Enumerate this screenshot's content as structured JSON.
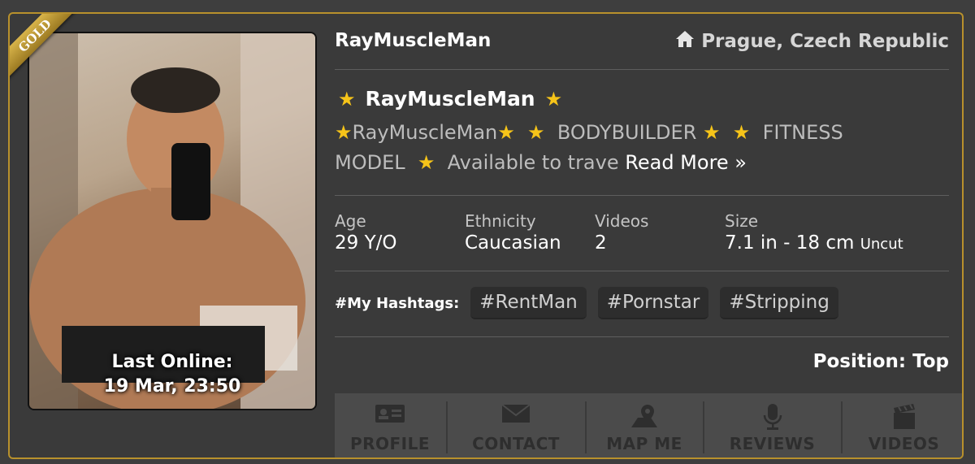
{
  "badge": "GOLD",
  "profile": {
    "username": "RayMuscleMan",
    "location": "Prague, Czech Republic",
    "last_online_label": "Last Online:",
    "last_online_value": "19 Mar, 23:50",
    "headline": "RayMuscleMan",
    "description": {
      "part1": "RayMuscleMan",
      "part2": "BODYBUILDER",
      "part3": "FITNESS",
      "part4": "MODEL",
      "part5": "Available to trave",
      "read_more": "Read More »"
    },
    "stats": [
      {
        "label": "Age",
        "value": "29 Y/O"
      },
      {
        "label": "Ethnicity",
        "value": "Caucasian"
      },
      {
        "label": "Videos",
        "value": "2"
      },
      {
        "label": "Size",
        "value": "7.1 in - 18 cm",
        "extra": "Uncut"
      }
    ],
    "hashtags_label": "#My Hashtags:",
    "hashtags": [
      "#RentMan",
      "#Pornstar",
      "#Stripping"
    ],
    "position": "Position: Top"
  },
  "nav": [
    {
      "label": "PROFILE",
      "icon": "id-card-icon"
    },
    {
      "label": "CONTACT",
      "icon": "envelope-icon"
    },
    {
      "label": "MAP ME",
      "icon": "map-pin-icon"
    },
    {
      "label": "REVIEWS",
      "icon": "microphone-icon"
    },
    {
      "label": "VIDEOS",
      "icon": "clapperboard-icon"
    }
  ],
  "colors": {
    "accent": "#b8912c",
    "star": "#f6c419",
    "card_bg": "#3a3a3a"
  }
}
